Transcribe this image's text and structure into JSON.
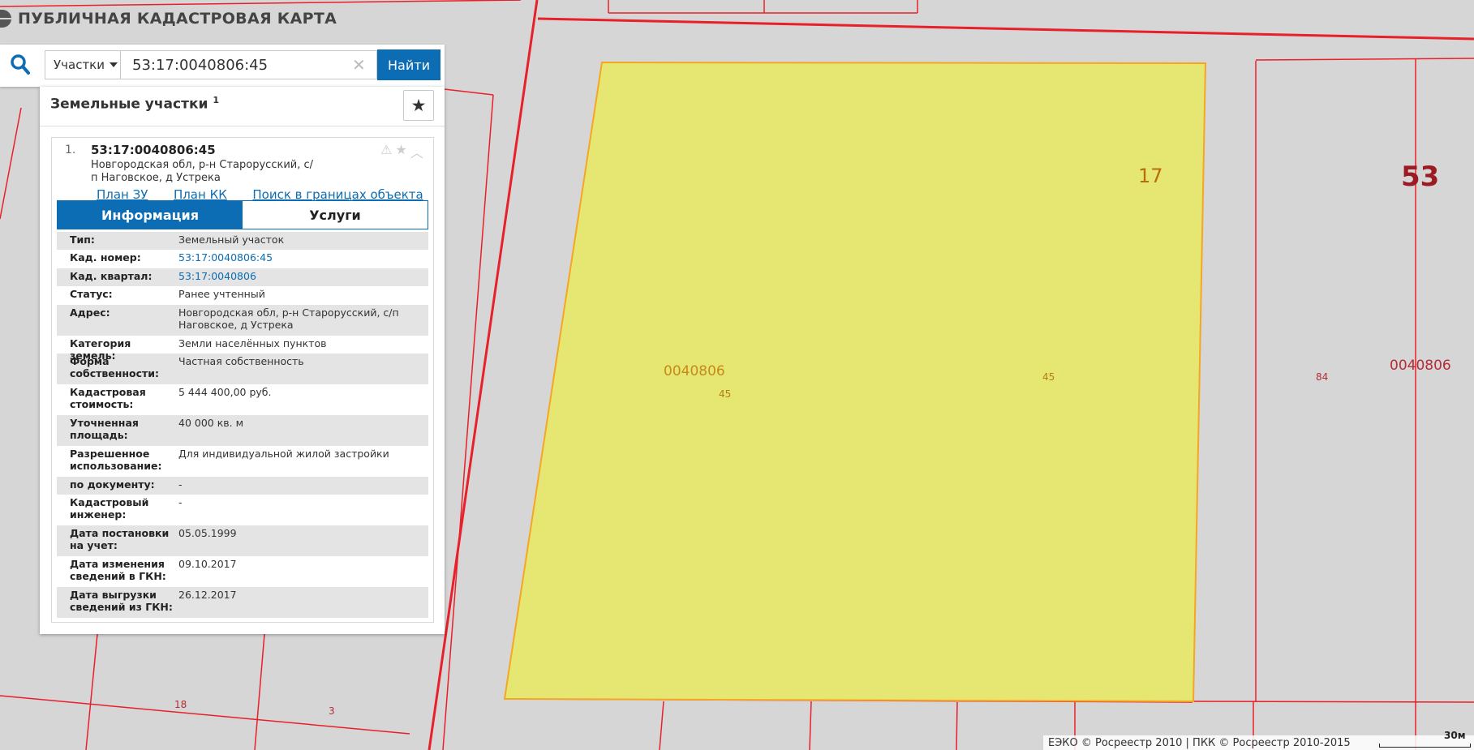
{
  "app": {
    "title": "ПУБЛИЧНАЯ КАДАСТРОВАЯ КАРТА"
  },
  "search": {
    "type_label": "Участки",
    "query": "53:17:0040806:45",
    "find_label": "Найти"
  },
  "panel": {
    "title": "Земельные участки",
    "count": "1",
    "result": {
      "index": "1.",
      "cad_number": "53:17:0040806:45",
      "address": "Новгородская обл, р-н Старорусский, с/п Наговское, д Устрека",
      "links": [
        "План ЗУ →",
        "План КК →",
        "Поиск в границах объекта →"
      ],
      "tabs": {
        "info": "Информация",
        "services": "Услуги"
      },
      "rows": [
        {
          "key": "Тип:",
          "value": "Земельный участок"
        },
        {
          "key": "Кад. номер:",
          "value": "53:17:0040806:45",
          "link": true
        },
        {
          "key": "Кад. квартал:",
          "value": "53:17:0040806",
          "link": true
        },
        {
          "key": "Статус:",
          "value": "Ранее учтенный"
        },
        {
          "key": "Адрес:",
          "value": "Новгородская обл, р-н Старорусский, с/п Наговское, д Устрека"
        },
        {
          "key": "Категория земель:",
          "value": "Земли населённых пунктов"
        },
        {
          "key": "Форма собственности:",
          "value": "Частная собственность"
        },
        {
          "key": "Кадастровая стоимость:",
          "value": "5 444 400,00 руб."
        },
        {
          "key": "Уточненная площадь:",
          "value": "40 000 кв. м"
        },
        {
          "key": "Разрешенное использование:",
          "value": "Для индивидуальной жилой застройки"
        },
        {
          "key": "по документу:",
          "value": "-"
        },
        {
          "key": "Кадастровый инженер:",
          "value": "-"
        },
        {
          "key": "Дата постановки на учет:",
          "value": "05.05.1999"
        },
        {
          "key": "Дата изменения сведений в ГКН:",
          "value": "09.10.2017"
        },
        {
          "key": "Дата выгрузки сведений из ГКН:",
          "value": "26.12.2017"
        }
      ]
    }
  },
  "map": {
    "labels": {
      "quarter_17": "17",
      "region_53": "53",
      "quarter_left": "0040806",
      "parcel_45_left": "45",
      "parcel_45_center": "45",
      "parcel_84": "84",
      "quarter_right": "0040806",
      "parcel_18": "18",
      "parcel_3": "3"
    },
    "colors": {
      "parcel_fill": "#e6e673",
      "parcel_stroke": "#f5a623",
      "boundary": "#e8202a",
      "background": "#d6d6d6"
    }
  },
  "footer": {
    "attribution": "ЕЭКО © Росреестр 2010 | ПКК © Росреестр 2010-2015",
    "scale": "30м"
  }
}
